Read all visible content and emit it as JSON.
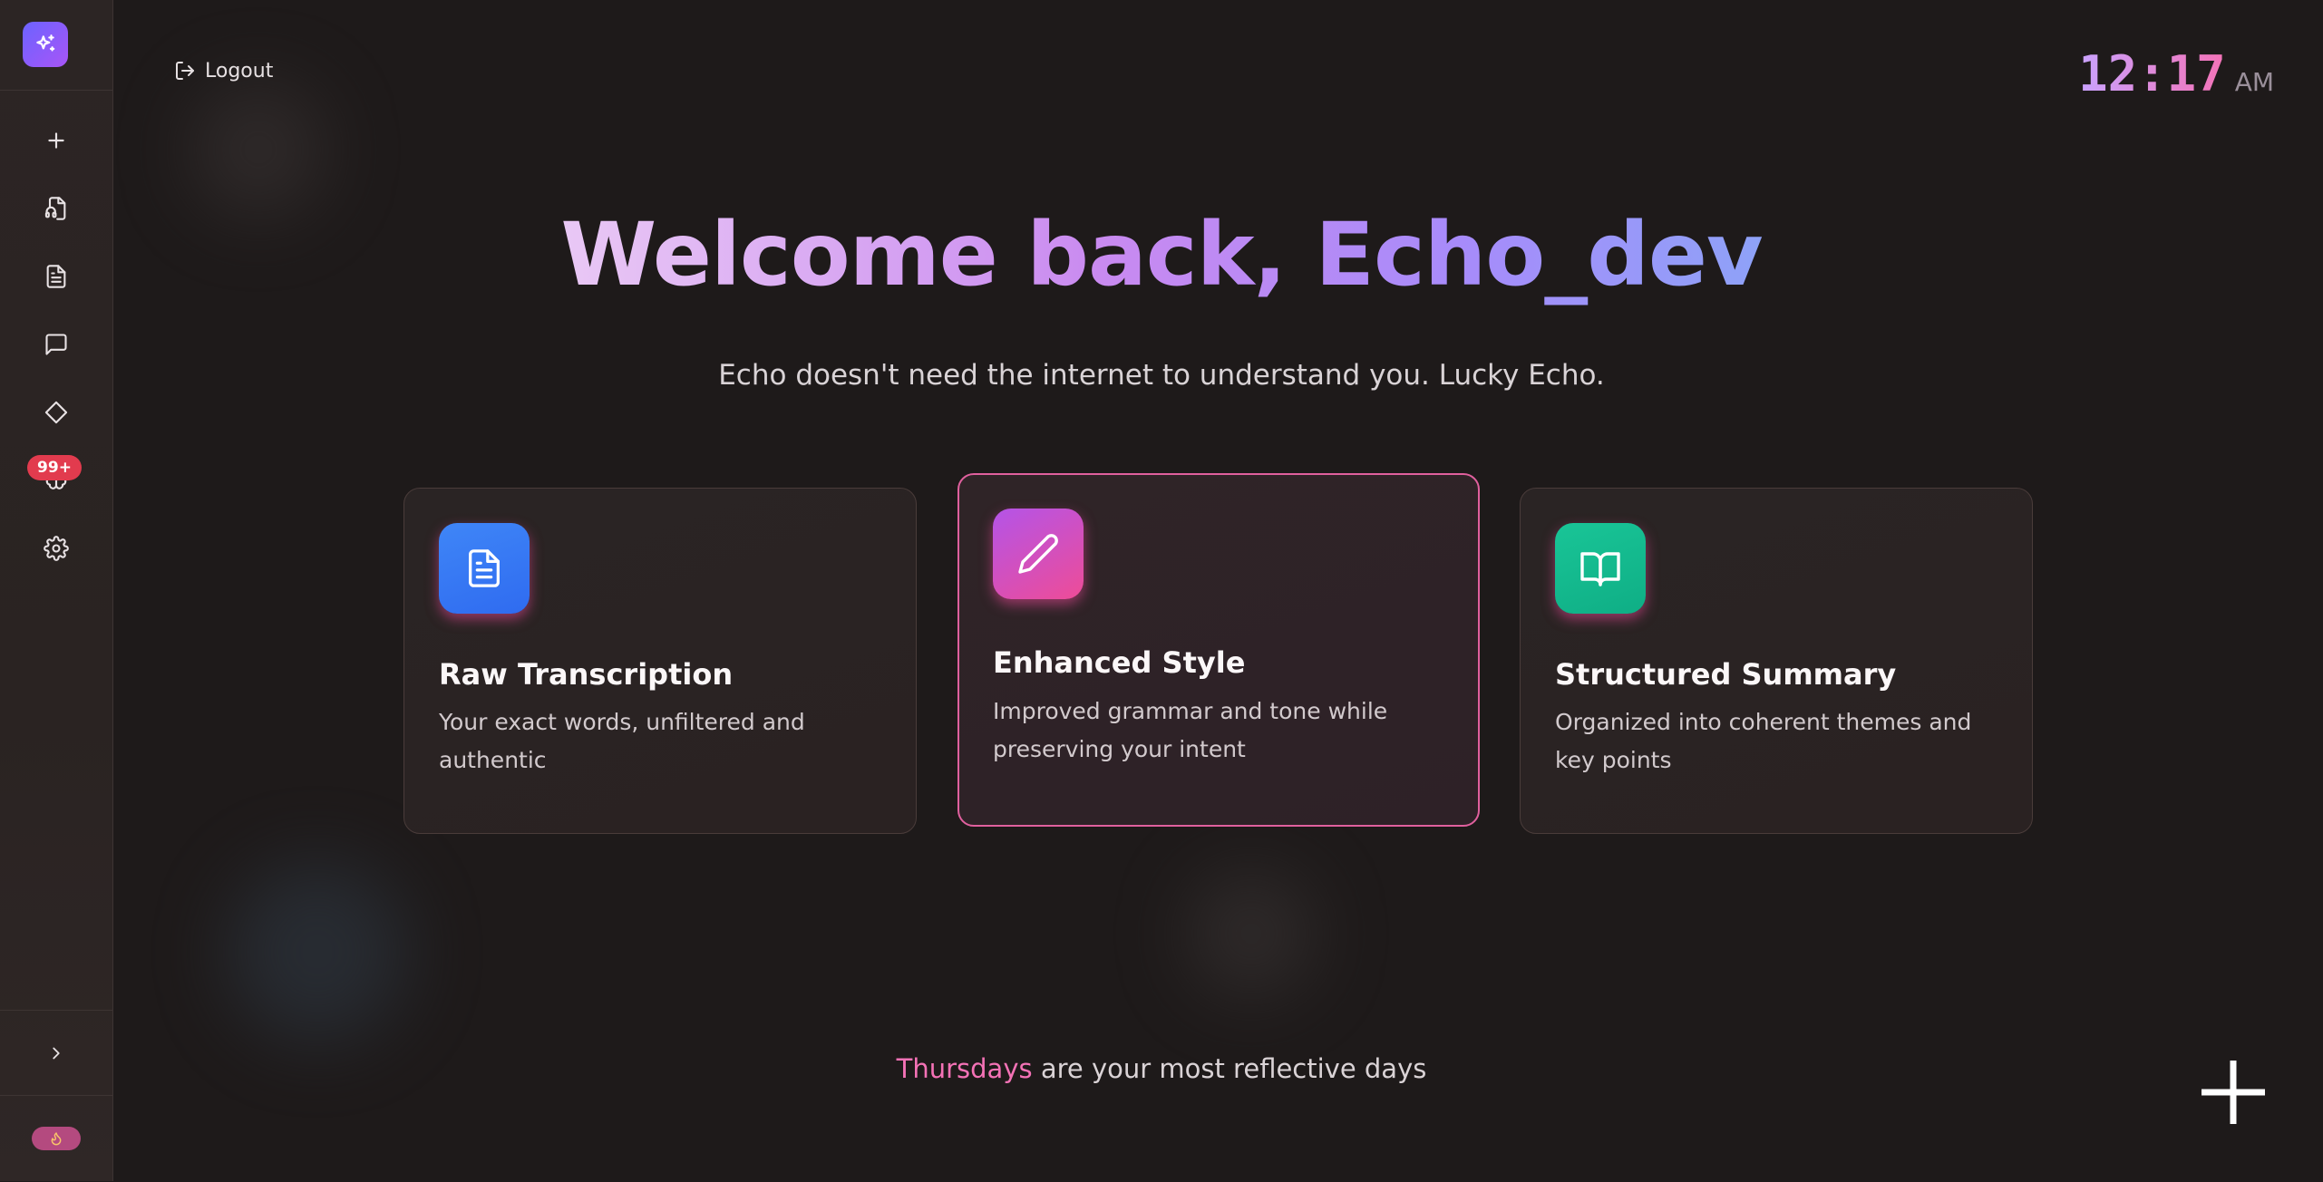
{
  "sidebar": {
    "logo_icon": "sparkles-icon",
    "items": [
      {
        "name": "new-note",
        "icon": "plus-icon"
      },
      {
        "name": "audio-files",
        "icon": "audio-file-icon"
      },
      {
        "name": "documents",
        "icon": "document-icon"
      },
      {
        "name": "chat",
        "icon": "chat-bubble-icon"
      },
      {
        "name": "tags",
        "icon": "diamond-icon"
      },
      {
        "name": "notifications",
        "icon": "brain-icon",
        "badge": "99+"
      },
      {
        "name": "settings",
        "icon": "gear-icon"
      }
    ],
    "expand_icon": "chevron-right-icon",
    "streak_icon": "flame-icon"
  },
  "header": {
    "logout_label": "Logout",
    "logout_icon": "logout-icon",
    "clock_hours": "12",
    "clock_minutes": "17",
    "clock_ampm": "AM"
  },
  "hero": {
    "title": "Welcome back, Echo_dev",
    "subtitle": "Echo doesn't need the internet to understand you. Lucky Echo."
  },
  "cards": [
    {
      "title": "Raw Transcription",
      "description": "Your exact words, unfiltered and authentic",
      "icon": "document-icon",
      "color": "#3b7cf5",
      "active": false
    },
    {
      "title": "Enhanced Style",
      "description": "Improved grammar and tone while preserving your intent",
      "icon": "pencil-icon",
      "color": "#c04fd8",
      "active": true
    },
    {
      "title": "Structured Summary",
      "description": "Organized into coherent themes and key points",
      "icon": "book-icon",
      "color": "#14b890",
      "active": false
    }
  ],
  "insight": {
    "highlight": "Thursdays",
    "text": " are your most reflective days"
  },
  "fab_icon": "plus-icon",
  "colors": {
    "background": "#1e1a1a",
    "accent_pink": "#f472b6",
    "accent_purple": "#a78bfa",
    "badge_red": "#e23b4e"
  }
}
